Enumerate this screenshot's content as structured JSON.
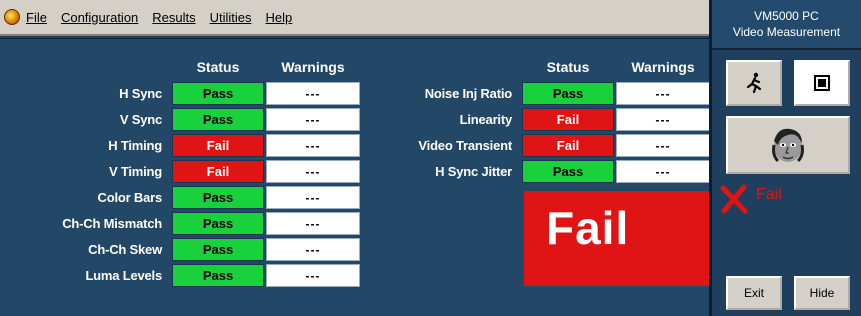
{
  "menu": {
    "icon": "app-logo-icon",
    "items": [
      "File",
      "Configuration",
      "Results",
      "Utilities",
      "Help"
    ]
  },
  "headers": {
    "status": "Status",
    "warnings": "Warnings"
  },
  "left_rows": [
    {
      "label": "H Sync",
      "status": "Pass",
      "warnings": "---"
    },
    {
      "label": "V Sync",
      "status": "Pass",
      "warnings": "---"
    },
    {
      "label": "H Timing",
      "status": "Fail",
      "warnings": "---"
    },
    {
      "label": "V Timing",
      "status": "Fail",
      "warnings": "---"
    },
    {
      "label": "Color Bars",
      "status": "Pass",
      "warnings": "---"
    },
    {
      "label": "Ch-Ch Mismatch",
      "status": "Pass",
      "warnings": "---"
    },
    {
      "label": "Ch-Ch Skew",
      "status": "Pass",
      "warnings": "---"
    },
    {
      "label": "Luma Levels",
      "status": "Pass",
      "warnings": "---"
    }
  ],
  "right_rows": [
    {
      "label": "Noise Inj Ratio",
      "status": "Pass",
      "warnings": "---"
    },
    {
      "label": "Linearity",
      "status": "Fail",
      "warnings": "---"
    },
    {
      "label": "Video Transient",
      "status": "Fail",
      "warnings": "---"
    },
    {
      "label": "H Sync Jitter",
      "status": "Pass",
      "warnings": "---"
    }
  ],
  "overall_result": "Fail",
  "side": {
    "product_line1": "VM5000 PC",
    "product_line2": "Video Measurement",
    "result_text": "Fail",
    "exit_label": "Exit",
    "hide_label": "Hide"
  },
  "colors": {
    "pass": "#19d13b",
    "fail": "#e01414",
    "background": "#234767"
  }
}
